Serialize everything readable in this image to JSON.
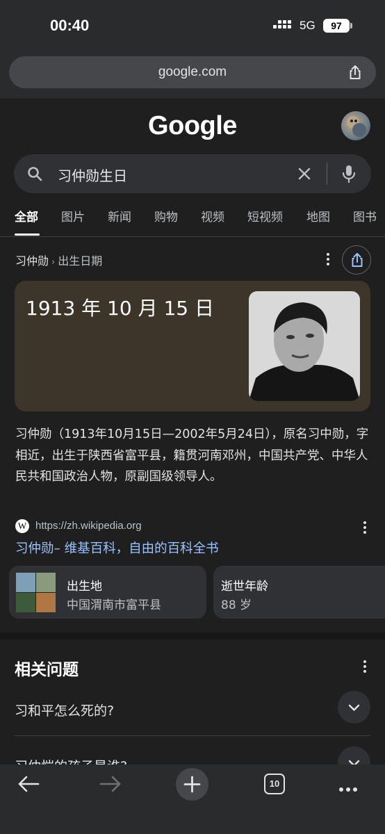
{
  "status_bar": {
    "time": "00:40",
    "network": "5G",
    "battery": "97"
  },
  "browser": {
    "url": "google.com",
    "tab_count": "10"
  },
  "google": {
    "logo": "Google"
  },
  "search": {
    "query": "习仲勋生日"
  },
  "tabs": [
    "全部",
    "图片",
    "新闻",
    "购物",
    "视频",
    "短视频",
    "地图",
    "图书"
  ],
  "knowledge": {
    "entity": "习仲勋",
    "attribute": "出生日期",
    "answer": "1913 年 10 月 15 日",
    "description": "习仲勋（1913年10月15日—2002年5月24日），原名习中勋，字相近，出生于陕西省富平县，籍贯河南邓州，中国共产党、中华人民共和国政治人物，原副国级领导人。",
    "source_icon": "W",
    "source_url": "https://zh.wikipedia.org",
    "source_title": "习仲勋– 维基百科，自由的百科全书",
    "cards": [
      {
        "title": "出生地",
        "value": "中国渭南市富平县"
      },
      {
        "title": "逝世年龄",
        "value": "88 岁"
      }
    ]
  },
  "related": {
    "title": "相关问题",
    "questions": [
      "习和平怎么死的?",
      "习仲恺的孩子是谁?"
    ]
  },
  "colors": {
    "background": "#1f1f1f",
    "link": "#99c3ff",
    "answer_card": "#3d342a"
  }
}
